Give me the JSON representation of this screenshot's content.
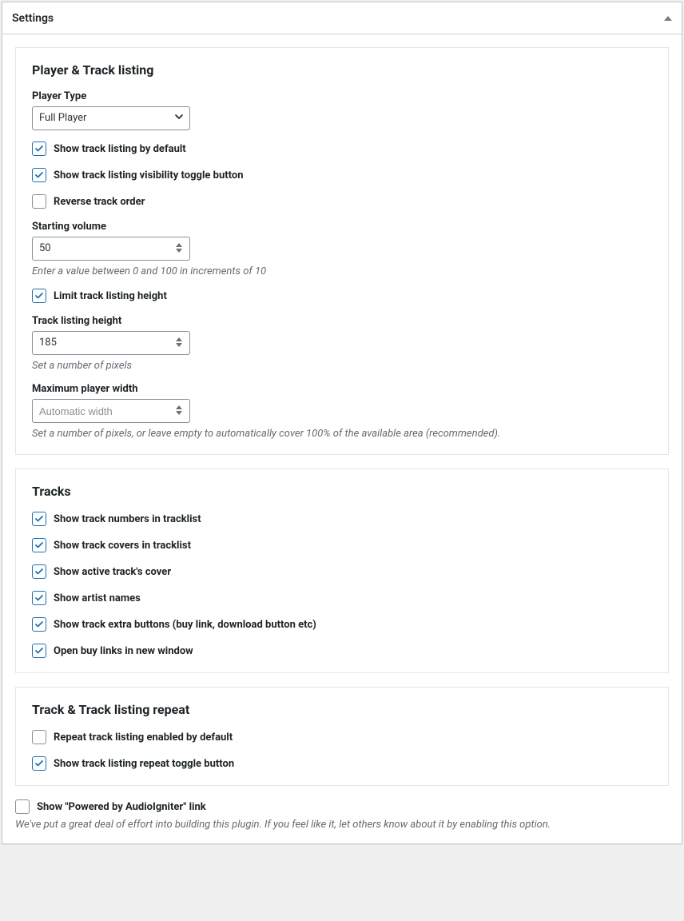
{
  "metabox": {
    "title": "Settings"
  },
  "section1": {
    "title": "Player & Track listing",
    "player_type_label": "Player Type",
    "player_type_value": "Full Player",
    "cb_show_listing": "Show track listing by default",
    "cb_show_toggle": "Show track listing visibility toggle button",
    "cb_reverse": "Reverse track order",
    "starting_volume_label": "Starting volume",
    "starting_volume_value": "50",
    "starting_volume_desc": "Enter a value between 0 and 100 in increments of 10",
    "cb_limit_height": "Limit track listing height",
    "listing_height_label": "Track listing height",
    "listing_height_value": "185",
    "listing_height_desc": "Set a number of pixels",
    "max_width_label": "Maximum player width",
    "max_width_placeholder": "Automatic width",
    "max_width_desc": "Set a number of pixels, or leave empty to automatically cover 100% of the available area (recommended)."
  },
  "section2": {
    "title": "Tracks",
    "cb_numbers": "Show track numbers in tracklist",
    "cb_covers": "Show track covers in tracklist",
    "cb_active_cover": "Show active track's cover",
    "cb_artist": "Show artist names",
    "cb_extra": "Show track extra buttons (buy link, download button etc)",
    "cb_newwin": "Open buy links in new window"
  },
  "section3": {
    "title": "Track & Track listing repeat",
    "cb_repeat_default": "Repeat track listing enabled by default",
    "cb_repeat_toggle": "Show track listing repeat toggle button"
  },
  "footer": {
    "cb_credit": "Show \"Powered by AudioIgniter\" link",
    "desc": "We've put a great deal of effort into building this plugin. If you feel like it, let others know about it by enabling this option."
  }
}
